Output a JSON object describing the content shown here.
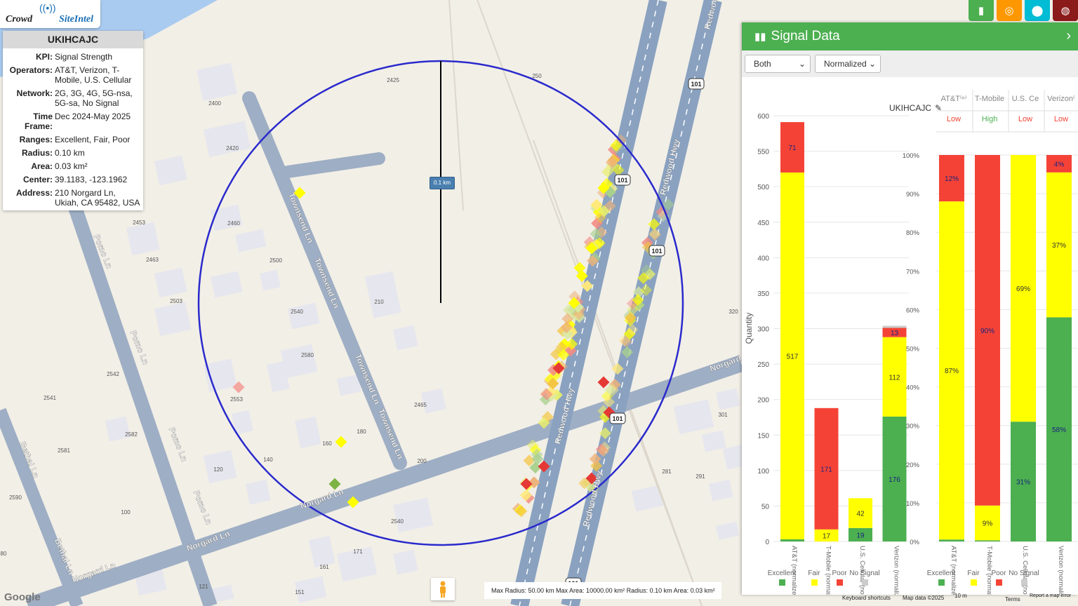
{
  "logo": {
    "text_a": "Crowd",
    "text_b": "SiteIntel",
    "icon": "broadcast-icon"
  },
  "info": {
    "title": "UKIHCAJC",
    "rows": [
      {
        "k": "KPI:",
        "v": "Signal Strength"
      },
      {
        "k": "Operators:",
        "v": "AT&T, Verizon, T-Mobile, U.S. Cellular"
      },
      {
        "k": "Network:",
        "v": "2G, 3G, 4G, 5G-nsa, 5G-sa, No Signal"
      },
      {
        "k": "Time Frame:",
        "v": "Dec 2024-May 2025"
      },
      {
        "k": "Ranges:",
        "v": "Excellent, Fair, Poor"
      },
      {
        "k": "Radius:",
        "v": "0.10 km"
      },
      {
        "k": "Area:",
        "v": "0.03 km²"
      },
      {
        "k": "Center:",
        "v": "39.1183, -123.1962"
      },
      {
        "k": "Address:",
        "v": "210 Norgard Ln, Ukiah, CA 95482, USA"
      }
    ]
  },
  "map": {
    "radius_label": "0.1 km",
    "street_labels": [
      "Townsend Ln",
      "Townsend Ln",
      "Townsend Ln",
      "Townsend Ln",
      "Pomo Ln",
      "Pomo Ln",
      "Pomo Ln",
      "Pomo Ln",
      "Bethal Ln",
      "Bethal Ln",
      "Norgard Ln",
      "Norgard Ln",
      "Norgard Ln",
      "Norgard",
      "Redwood Hwy",
      "Redwood Hwy",
      "Redwood Hwy",
      "Redwoo"
    ],
    "numbers": [
      "2425",
      "2400",
      "2420",
      "2453",
      "2460",
      "2463",
      "2500",
      "2503",
      "210",
      "2540",
      "2580",
      "2542",
      "2541",
      "2553",
      "2465",
      "2582",
      "2581",
      "180",
      "160",
      "140",
      "120",
      "200",
      "2590",
      "100",
      "2540",
      "171",
      "161",
      "121",
      "151",
      "301",
      "291",
      "281",
      "320",
      "250",
      "80"
    ],
    "shields": [
      "101",
      "101",
      "101",
      "101",
      "101"
    ],
    "scale_text": "Max Radius: 50.00 km Max Area: 10000.00 km² Radius: 0.10 km Area: 0.03 km²",
    "footer": {
      "shortcuts": "Keyboard shortcuts",
      "mapdata": "Map data ©2025",
      "scale": "10 m",
      "terms": "Terms",
      "report": "Report a map error"
    },
    "google": "Google"
  },
  "topbuttons": [
    {
      "icon": "bar-chart-icon",
      "color": "#4caf50"
    },
    {
      "icon": "target-icon",
      "color": "#ff9800"
    },
    {
      "icon": "location-pin-icon",
      "color": "#00bcd4"
    },
    {
      "icon": "globe-icon",
      "color": "#8b1a1a"
    }
  ],
  "panel": {
    "title": "Signal Data",
    "select1": "Both",
    "select2": "Normalized",
    "chart_title": "UKIHCAJC"
  },
  "chart_data": [
    {
      "type": "bar",
      "stacked": true,
      "ylabel": "Quantity",
      "ylim": [
        0,
        600
      ],
      "yticks": [
        "0",
        "50",
        "100",
        "150",
        "200",
        "250",
        "300",
        "350",
        "400",
        "450",
        "500",
        "550",
        "600"
      ],
      "categories": [
        "AT&T (normalized)",
        "T-Mobile (normalized)",
        "U.S. Cellular (normalized)",
        "Verizon (normalized)"
      ],
      "series": [
        {
          "name": "Excellent",
          "color": "#4caf50",
          "values": [
            3,
            0,
            19,
            176
          ],
          "labels": [
            "",
            "",
            "19",
            "176"
          ]
        },
        {
          "name": "Fair",
          "color": "#ffff00",
          "values": [
            517,
            17,
            42,
            112
          ],
          "labels": [
            "517",
            "17",
            "42",
            "112"
          ]
        },
        {
          "name": "Poor",
          "color": "#f44336",
          "values": [
            71,
            171,
            0,
            13
          ],
          "labels": [
            "71",
            "171",
            "",
            "13"
          ]
        },
        {
          "name": "No Signal",
          "color": "#cccccc",
          "values": [
            0,
            0,
            0,
            3
          ],
          "labels": [
            "",
            "",
            "",
            ""
          ]
        }
      ]
    },
    {
      "type": "bar",
      "stacked": true,
      "ylim": [
        0,
        100
      ],
      "yticks": [
        "0%",
        "10%",
        "20%",
        "30%",
        "40%",
        "50%",
        "60%",
        "70%",
        "80%",
        "90%",
        "100%"
      ],
      "columns": [
        "AT&T⁽ⁿ⁾",
        "T-Mobile",
        "U.S. Ce",
        "Verizon⁽"
      ],
      "levels": [
        {
          "text": "Low",
          "color": "#f44336"
        },
        {
          "text": "High",
          "color": "#4caf50"
        },
        {
          "text": "Low",
          "color": "#f44336"
        },
        {
          "text": "Low",
          "color": "#f44336"
        }
      ],
      "categories": [
        "AT&T (normalized)",
        "T-Mobile (normalized)",
        "U.S. Cellular (normalized)",
        "Verizon (normalized)"
      ],
      "series": [
        {
          "name": "Excellent",
          "color": "#4caf50",
          "values": [
            0.5,
            0.3,
            31,
            58
          ],
          "labels": [
            "",
            "",
            "31%",
            "58%"
          ]
        },
        {
          "name": "Fair",
          "color": "#ffff00",
          "values": [
            87.5,
            9,
            69,
            37.5
          ],
          "labels": [
            "87%",
            "9%",
            "69%",
            "37%"
          ]
        },
        {
          "name": "Poor",
          "color": "#f44336",
          "values": [
            12,
            90.7,
            0,
            4.5
          ],
          "labels": [
            "12%",
            "90%",
            "",
            "4%"
          ]
        }
      ]
    }
  ]
}
